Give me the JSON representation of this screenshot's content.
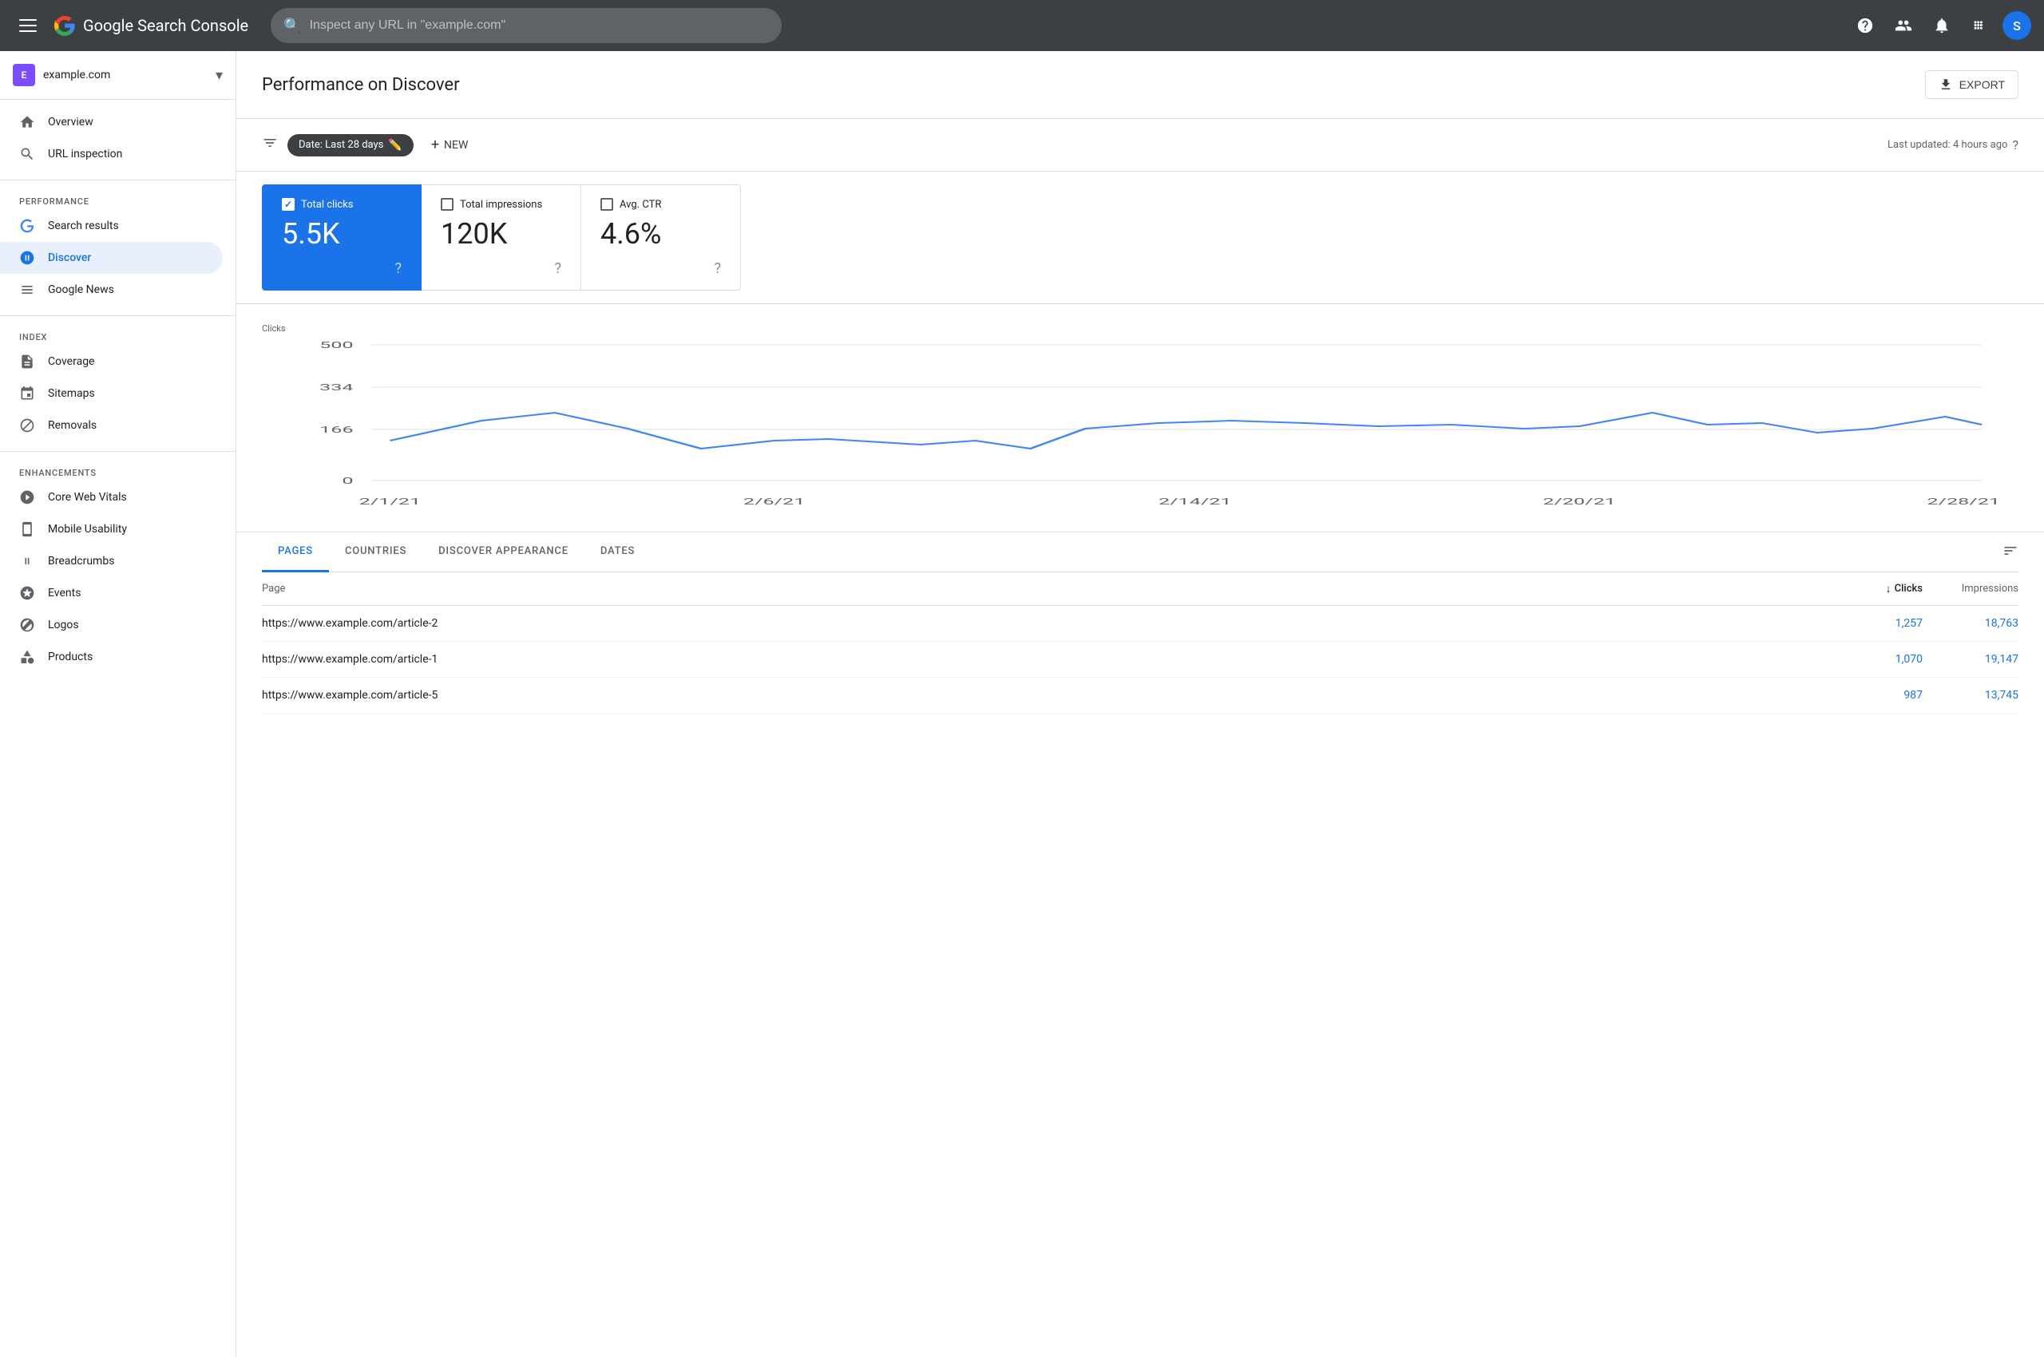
{
  "app": {
    "title": "Google Search Console",
    "logo_letter": "G"
  },
  "header": {
    "search_placeholder": "Inspect any URL in \"example.com\"",
    "user_avatar": "S"
  },
  "sidebar": {
    "site": {
      "name": "example.com",
      "icon": "E"
    },
    "nav": {
      "overview_label": "Overview",
      "url_inspection_label": "URL inspection",
      "performance_section_label": "Performance",
      "search_results_label": "Search results",
      "discover_label": "Discover",
      "google_news_label": "Google News",
      "index_section_label": "Index",
      "coverage_label": "Coverage",
      "sitemaps_label": "Sitemaps",
      "removals_label": "Removals",
      "enhancements_section_label": "Enhancements",
      "core_web_vitals_label": "Core Web Vitals",
      "mobile_usability_label": "Mobile Usability",
      "breadcrumbs_label": "Breadcrumbs",
      "events_label": "Events",
      "logos_label": "Logos",
      "products_label": "Products"
    }
  },
  "content": {
    "page_title": "Performance on Discover",
    "export_label": "EXPORT",
    "filter": {
      "date_label": "Date: Last 28 days",
      "new_label": "NEW",
      "last_updated": "Last updated: 4 hours ago"
    },
    "metrics": [
      {
        "label": "Total clicks",
        "value": "5.5K",
        "active": true
      },
      {
        "label": "Total impressions",
        "value": "120K",
        "active": false
      },
      {
        "label": "Avg. CTR",
        "value": "4.6%",
        "active": false
      }
    ],
    "chart": {
      "y_label": "Clicks",
      "y_values": [
        "500",
        "334",
        "166",
        "0"
      ],
      "x_labels": [
        "2/1/21",
        "2/6/21",
        "2/14/21",
        "2/20/21",
        "2/28/21"
      ]
    },
    "tabs": [
      {
        "label": "PAGES",
        "active": true
      },
      {
        "label": "COUNTRIES",
        "active": false
      },
      {
        "label": "DISCOVER APPEARANCE",
        "active": false
      },
      {
        "label": "DATES",
        "active": false
      }
    ],
    "table": {
      "col_page": "Page",
      "col_clicks": "Clicks",
      "col_impressions": "Impressions",
      "rows": [
        {
          "page": "https://www.example.com/article-2",
          "clicks": "1,257",
          "impressions": "18,763"
        },
        {
          "page": "https://www.example.com/article-1",
          "clicks": "1,070",
          "impressions": "19,147"
        },
        {
          "page": "https://www.example.com/article-5",
          "clicks": "987",
          "impressions": "13,745"
        }
      ]
    }
  }
}
